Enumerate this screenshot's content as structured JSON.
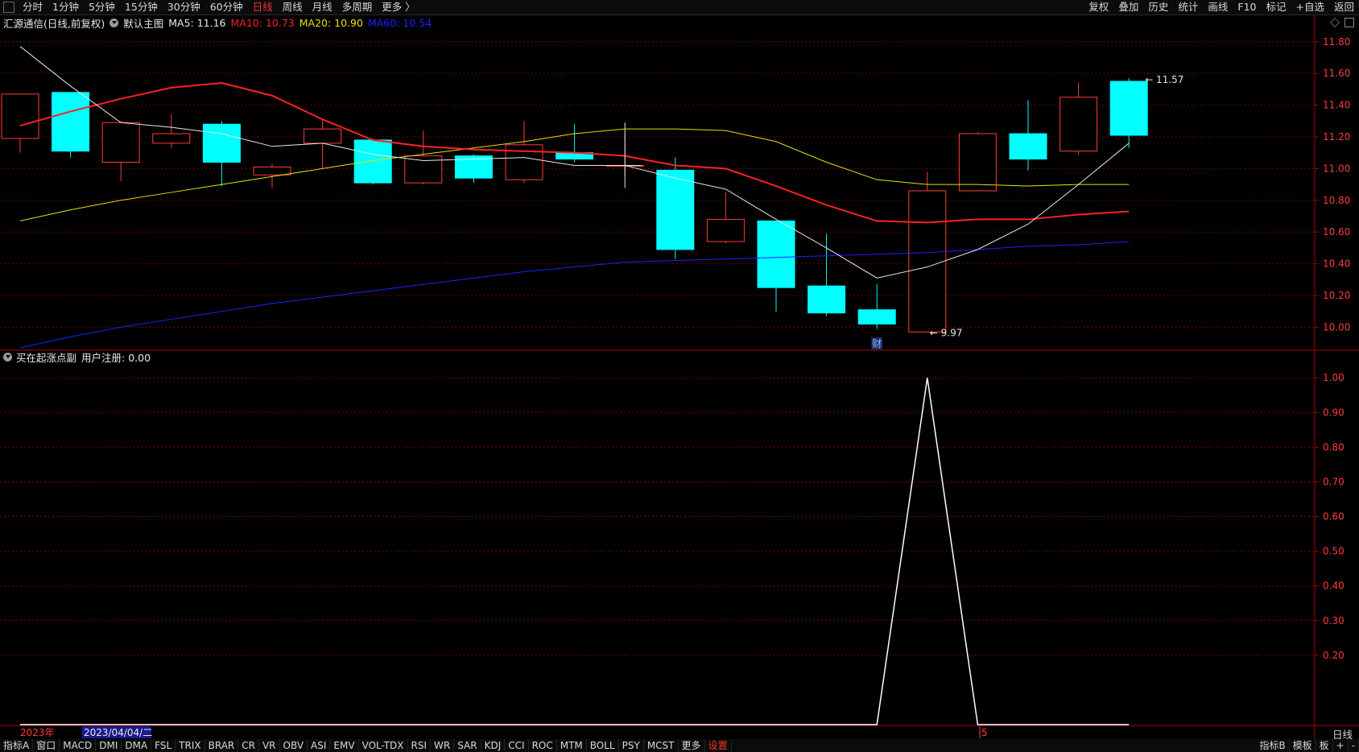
{
  "toolbar": {
    "periods": [
      "分时",
      "1分钟",
      "5分钟",
      "15分钟",
      "30分钟",
      "60分钟",
      "日线",
      "周线",
      "月线",
      "多周期",
      "更多 〉"
    ],
    "active_period": "日线",
    "right_items": [
      "复权",
      "叠加",
      "历史",
      "统计",
      "画线",
      "F10",
      "标记",
      "+自选",
      "返回"
    ]
  },
  "main_legend": {
    "stock": "汇源通信(日线,前复权)",
    "template": "默认主图",
    "ma5": "MA5: 11.16",
    "ma10": "MA10: 10.73",
    "ma20": "MA20: 10.90",
    "ma60": "MA60: 10.54"
  },
  "sub_legend": {
    "name": "买在起涨点副",
    "field": "用户注册: 0.00"
  },
  "colors": {
    "up": "#ff3b3b",
    "down": "#00ffff",
    "ma5": "#e8e8e8",
    "ma10": "#ff2020",
    "ma20": "#e8e000",
    "ma60": "#2020ff",
    "grid": "#7a0000",
    "axis_text": "#ff3b3b",
    "indicator": "#ffffff"
  },
  "chart_data": [
    {
      "type": "candlestick",
      "ylim": [
        9.86,
        11.88
      ],
      "ticks": [
        "11.80",
        "11.60",
        "11.40",
        "11.20",
        "11.00",
        "10.80",
        "10.60",
        "10.40",
        "10.20",
        "10.00"
      ],
      "candles": [
        {
          "open": 11.19,
          "close": 11.47,
          "high": 11.47,
          "low": 11.1
        },
        {
          "open": 11.48,
          "close": 11.11,
          "high": 11.48,
          "low": 11.07
        },
        {
          "open": 11.04,
          "close": 11.29,
          "high": 11.3,
          "low": 10.92
        },
        {
          "open": 11.16,
          "close": 11.22,
          "high": 11.34,
          "low": 11.13
        },
        {
          "open": 11.28,
          "close": 11.04,
          "high": 11.3,
          "low": 10.89
        },
        {
          "open": 10.96,
          "close": 11.01,
          "high": 11.03,
          "low": 10.88
        },
        {
          "open": 11.16,
          "close": 11.25,
          "high": 11.3,
          "low": 11.0
        },
        {
          "open": 11.18,
          "close": 10.91,
          "high": 11.19,
          "low": 10.9
        },
        {
          "open": 10.91,
          "close": 11.08,
          "high": 11.24,
          "low": 10.9
        },
        {
          "open": 11.08,
          "close": 10.94,
          "high": 11.09,
          "low": 10.91
        },
        {
          "open": 10.93,
          "close": 11.15,
          "high": 11.3,
          "low": 10.91
        },
        {
          "open": 11.1,
          "close": 11.06,
          "high": 11.28,
          "low": 11.04
        },
        {
          "open": 11.02,
          "close": 11.02,
          "high": 11.22,
          "low": 10.95
        },
        {
          "open": 10.99,
          "close": 10.49,
          "high": 11.07,
          "low": 10.43
        },
        {
          "open": 10.54,
          "close": 10.68,
          "high": 10.85,
          "low": 10.53
        },
        {
          "open": 10.67,
          "close": 10.25,
          "high": 10.67,
          "low": 10.1
        },
        {
          "open": 10.26,
          "close": 10.09,
          "high": 10.59,
          "low": 10.07
        },
        {
          "open": 10.11,
          "close": 10.02,
          "high": 10.27,
          "low": 9.99
        },
        {
          "open": 9.97,
          "close": 10.86,
          "high": 10.98,
          "low": 9.97
        },
        {
          "open": 10.86,
          "close": 11.22,
          "high": 11.23,
          "low": 10.86
        },
        {
          "open": 11.22,
          "close": 11.06,
          "high": 11.43,
          "low": 10.99
        },
        {
          "open": 11.11,
          "close": 11.45,
          "high": 11.54,
          "low": 11.09
        },
        {
          "open": 11.55,
          "close": 11.21,
          "high": 11.57,
          "low": 11.13
        }
      ],
      "ma5": [
        11.77,
        11.52,
        11.29,
        11.26,
        11.22,
        11.14,
        11.16,
        11.09,
        11.05,
        11.06,
        11.07,
        11.02,
        11.02,
        10.94,
        10.87,
        10.68,
        10.5,
        10.31,
        10.38,
        10.49,
        10.65,
        10.9,
        11.16
      ],
      "ma10": [
        11.27,
        11.36,
        11.44,
        11.51,
        11.54,
        11.46,
        11.31,
        11.18,
        11.14,
        11.12,
        11.11,
        11.1,
        11.08,
        11.02,
        11.0,
        10.89,
        10.77,
        10.67,
        10.66,
        10.68,
        10.68,
        10.71,
        10.73
      ],
      "ma20": [
        10.67,
        10.74,
        10.8,
        10.85,
        10.9,
        10.95,
        11.0,
        11.05,
        11.09,
        11.13,
        11.17,
        11.22,
        11.25,
        11.25,
        11.24,
        11.17,
        11.04,
        10.93,
        10.9,
        10.9,
        10.89,
        10.9,
        10.9
      ],
      "ma60": [
        9.87,
        9.94,
        10.0,
        10.05,
        10.1,
        10.15,
        10.19,
        10.23,
        10.27,
        10.31,
        10.35,
        10.38,
        10.41,
        10.42,
        10.43,
        10.44,
        10.45,
        10.46,
        10.47,
        10.49,
        10.51,
        10.52,
        10.54
      ],
      "annotations": {
        "high": "11.57",
        "low": "9.97",
        "marker": "财"
      }
    },
    {
      "type": "line",
      "ylim": [
        0,
        1.04
      ],
      "ticks": [
        "1.00",
        "0.90",
        "0.80",
        "0.70",
        "0.60",
        "0.50",
        "0.40",
        "0.30",
        "0.20"
      ],
      "series": [
        {
          "values": [
            0,
            0,
            0,
            0,
            0,
            0,
            0,
            0,
            0,
            0,
            0,
            0,
            0,
            0,
            0,
            0,
            0,
            0,
            1.0,
            0,
            0,
            0,
            0
          ]
        }
      ]
    }
  ],
  "date_axis": {
    "year_label": "2023年",
    "cursor_date": "2023/04/04/二",
    "month_label": "5"
  },
  "period_label": "日线",
  "bottom_tabs": [
    "指标A",
    "窗口",
    "MACD",
    "DMI",
    "DMA",
    "FSL",
    "TRIX",
    "BRAR",
    "CR",
    "VR",
    "OBV",
    "ASI",
    "EMV",
    "VOL-TDX",
    "RSI",
    "WR",
    "SAR",
    "KDJ",
    "CCI",
    "ROC",
    "MTM",
    "BOLL",
    "PSY",
    "MCST",
    "更多",
    "设置"
  ],
  "bottom_active": "设置",
  "bottom_right": [
    "指标B",
    "模板",
    "板",
    "+",
    "-"
  ]
}
